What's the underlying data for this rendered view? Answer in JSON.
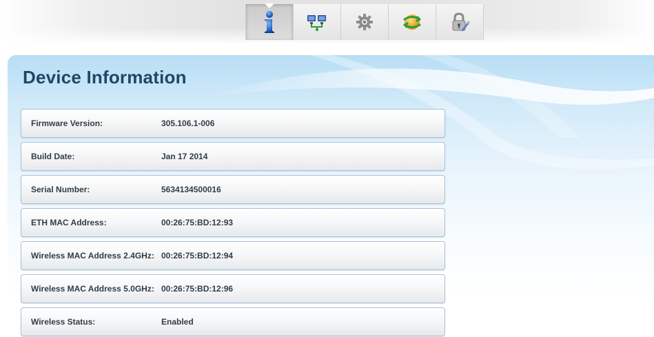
{
  "toolbar": {
    "tabs": [
      {
        "icon": "info-icon",
        "active": true
      },
      {
        "icon": "network-icon",
        "active": false
      },
      {
        "icon": "gear-icon",
        "active": false
      },
      {
        "icon": "refresh-globe-icon",
        "active": false
      },
      {
        "icon": "lock-icon",
        "active": false
      }
    ]
  },
  "page": {
    "title": "Device Information"
  },
  "device_info": [
    {
      "label": "Firmware Version:",
      "value": "305.106.1-006"
    },
    {
      "label": "Build Date:",
      "value": "Jan 17 2014"
    },
    {
      "label": "Serial Number:",
      "value": "5634134500016"
    },
    {
      "label": "ETH MAC Address:",
      "value": "00:26:75:BD:12:93"
    },
    {
      "label": "Wireless MAC Address 2.4GHz:",
      "value": "00:26:75:BD:12:94"
    },
    {
      "label": "Wireless MAC Address 5.0GHz:",
      "value": "00:26:75:BD:12:96"
    },
    {
      "label": "Wireless Status:",
      "value": "Enabled"
    }
  ],
  "colors": {
    "title": "#1f4766",
    "panel_top": "#b8def5",
    "row_border": "#a9c1d6"
  }
}
